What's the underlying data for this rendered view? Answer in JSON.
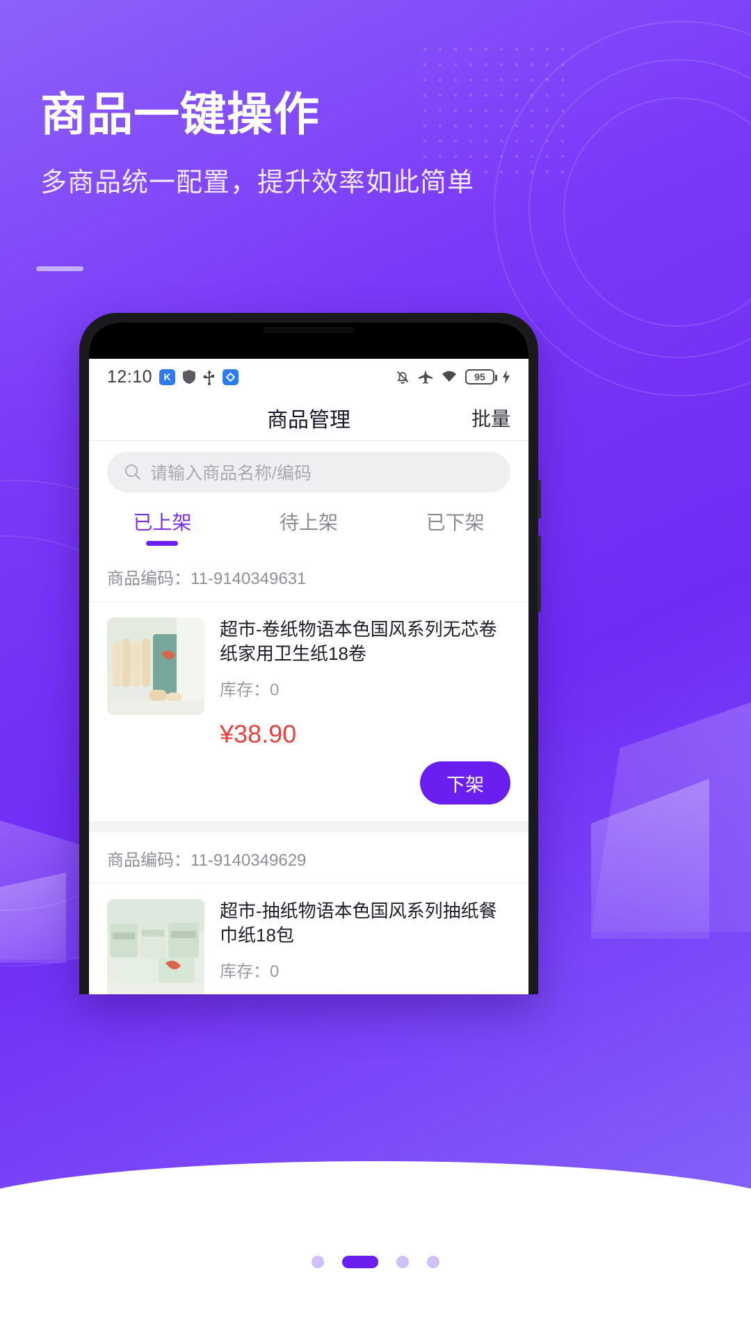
{
  "promo": {
    "headline": "商品一键操作",
    "subheadline": "多商品统一配置，提升效率如此简单",
    "accent_color": "#6a1ff0"
  },
  "status_bar": {
    "clock": "12:10",
    "left_icons": [
      "k-app-icon",
      "shield-icon",
      "usb-icon",
      "diamond-app-icon"
    ],
    "right_icons": [
      "bell-off-icon",
      "airplane-mode-icon",
      "wifi-icon",
      "battery-icon",
      "charging-bolt-icon"
    ],
    "battery_level": "95"
  },
  "header": {
    "title": "商品管理",
    "batch_label": "批量"
  },
  "search": {
    "placeholder": "请输入商品名称/编码",
    "icon": "search-icon"
  },
  "tabs": [
    {
      "label": "已上架",
      "active": true
    },
    {
      "label": "待上架",
      "active": false
    },
    {
      "label": "已下架",
      "active": false
    }
  ],
  "products": [
    {
      "code_label": "商品编码：",
      "code": "11-9140349631",
      "title": "超市-卷纸物语本色国风系列无芯卷纸家用卫生纸18卷",
      "stock_label": "库存：",
      "stock": "0",
      "price": "¥38.90",
      "price_color": "#e8413f",
      "action_label": "下架"
    },
    {
      "code_label": "商品编码：",
      "code": "11-9140349629",
      "title": "超市-抽纸物语本色国风系列抽纸餐巾纸18包",
      "stock_label": "库存：",
      "stock": "0",
      "price": "",
      "price_color": "#e8413f",
      "action_label": ""
    }
  ],
  "pagination": {
    "total": 4,
    "active_index": 1
  }
}
